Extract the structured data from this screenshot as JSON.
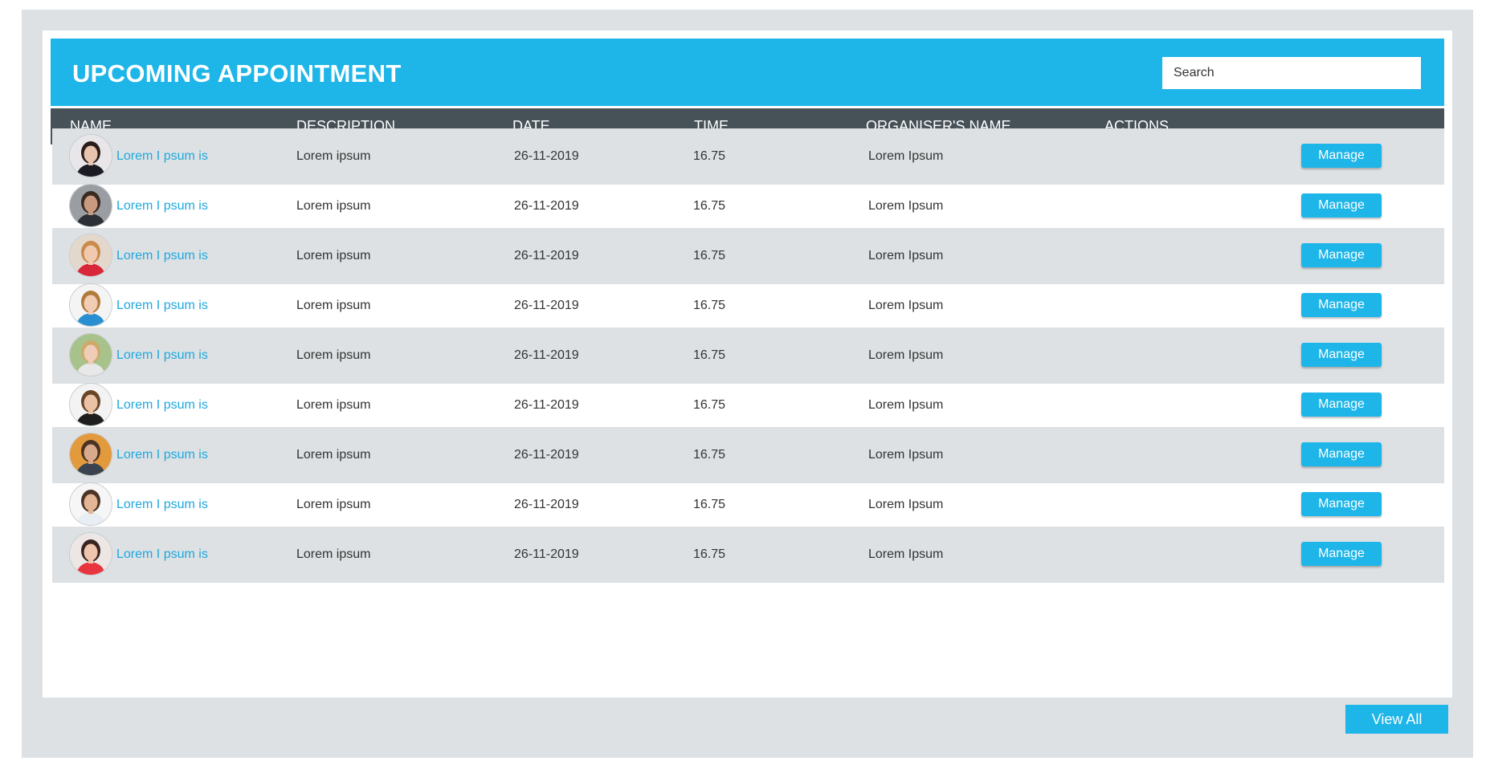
{
  "header": {
    "title": "UPCOMING APPOINTMENT",
    "search_placeholder": "Search",
    "search_value": ""
  },
  "columns": [
    "NAME",
    "DESCRIPTION",
    "DATE",
    "TIME",
    "ORGANISER'S NAME",
    "ACTIONS"
  ],
  "rows": [
    {
      "name": "Lorem I psum is",
      "description": "Lorem ipsum",
      "date": "26-11-2019",
      "time": "16.75",
      "organiser": "Lorem Ipsum",
      "action": "Manage",
      "avatar": "woman-dark-hair-avatar"
    },
    {
      "name": "Lorem I psum is",
      "description": "Lorem ipsum",
      "date": "26-11-2019",
      "time": "16.75",
      "organiser": "Lorem Ipsum",
      "action": "Manage",
      "avatar": "bearded-man-avatar"
    },
    {
      "name": "Lorem I psum is",
      "description": "Lorem ipsum",
      "date": "26-11-2019",
      "time": "16.75",
      "organiser": "Lorem Ipsum",
      "action": "Manage",
      "avatar": "blonde-woman-avatar"
    },
    {
      "name": "Lorem I psum is",
      "description": "Lorem ipsum",
      "date": "26-11-2019",
      "time": "16.75",
      "organiser": "Lorem Ipsum",
      "action": "Manage",
      "avatar": "woman-smiling-avatar"
    },
    {
      "name": "Lorem I psum is",
      "description": "Lorem ipsum",
      "date": "26-11-2019",
      "time": "16.75",
      "organiser": "Lorem Ipsum",
      "action": "Manage",
      "avatar": "woman-outdoor-avatar"
    },
    {
      "name": "Lorem I psum is",
      "description": "Lorem ipsum",
      "date": "26-11-2019",
      "time": "16.75",
      "organiser": "Lorem Ipsum",
      "action": "Manage",
      "avatar": "woman-brown-hair-avatar"
    },
    {
      "name": "Lorem I psum is",
      "description": "Lorem ipsum",
      "date": "26-11-2019",
      "time": "16.75",
      "organiser": "Lorem Ipsum",
      "action": "Manage",
      "avatar": "man-glasses-avatar"
    },
    {
      "name": "Lorem I psum is",
      "description": "Lorem ipsum",
      "date": "26-11-2019",
      "time": "16.75",
      "organiser": "Lorem Ipsum",
      "action": "Manage",
      "avatar": "man-smiling-avatar"
    },
    {
      "name": "Lorem I psum is",
      "description": "Lorem ipsum",
      "date": "26-11-2019",
      "time": "16.75",
      "organiser": "Lorem Ipsum",
      "action": "Manage",
      "avatar": "woman-red-shirt-avatar"
    }
  ],
  "footer": {
    "view_all_label": "View All"
  },
  "colors": {
    "accent": "#1eb5e8",
    "table_header": "#465158",
    "row_shade": "#dde1e4",
    "link": "#1ea8dd"
  }
}
